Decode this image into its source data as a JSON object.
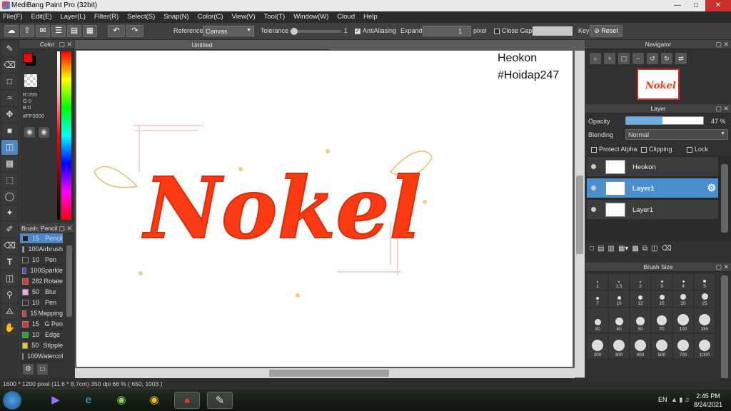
{
  "window": {
    "title": "MediBang Paint Pro (32bit)"
  },
  "menu": [
    "File(F)",
    "Edit(E)",
    "Layer(L)",
    "Filter(R)",
    "Select(S)",
    "Snap(N)",
    "Color(C)",
    "View(V)",
    "Tool(T)",
    "Window(W)",
    "Cloud",
    "Help"
  ],
  "toolbar": {
    "reference_label": "Reference",
    "reference_value": "Canvas",
    "tolerance_label": "Tolerance",
    "tolerance_value": "1",
    "tolerance_level": 1,
    "antialiasing_label": "AntiAliasing",
    "expand_label": "Expand",
    "expand_value": "1",
    "expand_unit": "pixel",
    "closegaps_label": "Close Gaps",
    "key_label": "Key",
    "reset_label": "Reset"
  },
  "color_panel": {
    "title": "Color",
    "fg_color": "#FF0000",
    "r": "R:255",
    "g": "G:0",
    "b": "B:0",
    "hex": "#FF0000"
  },
  "brush_panel": {
    "title": "Brush: Pencil",
    "items": [
      {
        "size": "15",
        "name": "Pencil",
        "color": "#222222"
      },
      {
        "size": "100",
        "name": "Airbrush",
        "color": "#bbbbbb"
      },
      {
        "size": "10",
        "name": "Pen",
        "color": "#333333"
      },
      {
        "size": "100",
        "name": "Sparkle",
        "color": "#3b4fd6"
      },
      {
        "size": "282",
        "name": "Rotate",
        "color": "#e33333"
      },
      {
        "size": "50",
        "name": "Blur",
        "color": "#f5a8e8"
      },
      {
        "size": "10",
        "name": "Pen",
        "color": "#333333"
      },
      {
        "size": "15",
        "name": "Mapping",
        "color": "#e33333"
      },
      {
        "size": "15",
        "name": "G Pen",
        "color": "#e33333"
      },
      {
        "size": "10",
        "name": "Edge",
        "color": "#22aa22"
      },
      {
        "size": "50",
        "name": "Stipple",
        "color": "#e0d020"
      },
      {
        "size": "100",
        "name": "Watercolor",
        "color": "#55ccee"
      }
    ]
  },
  "document": {
    "tab_title": "Untitled",
    "canvas_text_1": "Heokon",
    "canvas_text_2": "#Hoidap247",
    "art_word": "Nokel"
  },
  "navigator": {
    "title": "Navigator"
  },
  "layer_panel": {
    "title": "Layer",
    "opacity_label": "Opacity",
    "opacity_value": "47 %",
    "opacity_level": 0.47,
    "blending_label": "Blending",
    "blending_value": "Normal",
    "protect_alpha": "Protect Alpha",
    "clipping": "Clipping",
    "lock": "Lock",
    "layers": [
      {
        "name": "Heokon",
        "selected": false
      },
      {
        "name": "Layer1",
        "selected": true
      },
      {
        "name": "Layer1",
        "selected": false
      }
    ]
  },
  "brush_size_panel": {
    "title": "Brush Size",
    "sizes": [
      "1",
      "1.5",
      "2",
      "3",
      "4",
      "5",
      "7",
      "10",
      "12",
      "15",
      "20",
      "25",
      "30",
      "40",
      "50",
      "70",
      "100",
      "150",
      "200",
      "300",
      "400",
      "500",
      "700",
      "1000"
    ]
  },
  "status": {
    "dimensions": "1600 * 1200 pixel",
    "physical": "(11.6 * 8.7cm)",
    "dpi": "350 dpi",
    "zoom": "66 %",
    "cursor": "( 650, 1003 )"
  },
  "taskbar": {
    "lang": "EN",
    "time": "2:45 PM",
    "date": "8/24/2021"
  }
}
